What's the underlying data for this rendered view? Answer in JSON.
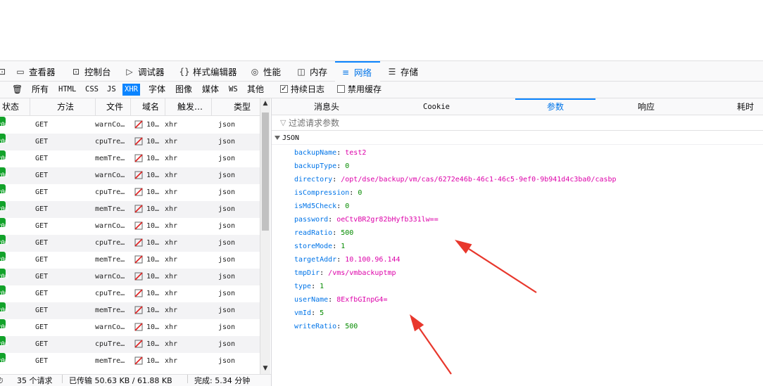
{
  "toolbar": {
    "tabs": [
      {
        "label": "查看器",
        "icon": "inspector-icon"
      },
      {
        "label": "控制台",
        "icon": "console-icon"
      },
      {
        "label": "调试器",
        "icon": "debugger-icon"
      },
      {
        "label": "样式编辑器",
        "icon": "style-editor-icon"
      },
      {
        "label": "性能",
        "icon": "performance-icon"
      },
      {
        "label": "内存",
        "icon": "memory-icon"
      },
      {
        "label": "网络",
        "icon": "network-icon",
        "active": true
      },
      {
        "label": "存储",
        "icon": "storage-icon"
      }
    ]
  },
  "filters": {
    "types": [
      "所有",
      "HTML",
      "CSS",
      "JS",
      "XHR",
      "字体",
      "图像",
      "媒体",
      "WS",
      "其他"
    ],
    "active_type": "XHR",
    "persist_logs": {
      "label": "持续日志",
      "checked": true
    },
    "disable_cache": {
      "label": "禁用缓存",
      "checked": false
    }
  },
  "table": {
    "columns": [
      "状态",
      "方法",
      "文件",
      "域名",
      "触发…",
      "类型"
    ],
    "rows": [
      {
        "status": "200",
        "method": "GET",
        "file": "warnCo…",
        "domain": "10…",
        "cause": "xhr",
        "type": "json"
      },
      {
        "status": "200",
        "method": "GET",
        "file": "cpuTre…",
        "domain": "10…",
        "cause": "xhr",
        "type": "json"
      },
      {
        "status": "200",
        "method": "GET",
        "file": "memTre…",
        "domain": "10…",
        "cause": "xhr",
        "type": "json"
      },
      {
        "status": "200",
        "method": "GET",
        "file": "warnCo…",
        "domain": "10…",
        "cause": "xhr",
        "type": "json"
      },
      {
        "status": "200",
        "method": "GET",
        "file": "cpuTre…",
        "domain": "10…",
        "cause": "xhr",
        "type": "json"
      },
      {
        "status": "200",
        "method": "GET",
        "file": "memTre…",
        "domain": "10…",
        "cause": "xhr",
        "type": "json"
      },
      {
        "status": "200",
        "method": "GET",
        "file": "warnCo…",
        "domain": "10…",
        "cause": "xhr",
        "type": "json"
      },
      {
        "status": "200",
        "method": "GET",
        "file": "cpuTre…",
        "domain": "10…",
        "cause": "xhr",
        "type": "json"
      },
      {
        "status": "200",
        "method": "GET",
        "file": "memTre…",
        "domain": "10…",
        "cause": "xhr",
        "type": "json"
      },
      {
        "status": "200",
        "method": "GET",
        "file": "warnCo…",
        "domain": "10…",
        "cause": "xhr",
        "type": "json"
      },
      {
        "status": "200",
        "method": "GET",
        "file": "cpuTre…",
        "domain": "10…",
        "cause": "xhr",
        "type": "json"
      },
      {
        "status": "200",
        "method": "GET",
        "file": "memTre…",
        "domain": "10…",
        "cause": "xhr",
        "type": "json"
      },
      {
        "status": "200",
        "method": "GET",
        "file": "warnCo…",
        "domain": "10…",
        "cause": "xhr",
        "type": "json"
      },
      {
        "status": "200",
        "method": "GET",
        "file": "cpuTre…",
        "domain": "10…",
        "cause": "xhr",
        "type": "json"
      },
      {
        "status": "200",
        "method": "GET",
        "file": "memTre…",
        "domain": "10…",
        "cause": "xhr",
        "type": "json"
      }
    ]
  },
  "statusbar": {
    "requests": "35 个请求",
    "transferred": "已传输 50.63 KB / 61.88 KB",
    "finish": "完成: 5.34 分钟"
  },
  "details": {
    "tabs": [
      "消息头",
      "Cookie",
      "参数",
      "响应",
      "耗时"
    ],
    "active_tab": "参数",
    "filter_placeholder": "过滤请求参数",
    "json_label": "JSON",
    "params": [
      {
        "key": "backupName",
        "value": "test2",
        "kind": "str"
      },
      {
        "key": "backupType",
        "value": "0",
        "kind": "num"
      },
      {
        "key": "directory",
        "value": "/opt/dse/backup/vm/cas/6272e46b-46c1-46c5-9ef0-9b941d4c3ba0/casbp",
        "kind": "str"
      },
      {
        "key": "isCompression",
        "value": "0",
        "kind": "num"
      },
      {
        "key": "isMd5Check",
        "value": "0",
        "kind": "num"
      },
      {
        "key": "password",
        "value": "oeCtvBR2gr82bHyfb331lw==",
        "kind": "str"
      },
      {
        "key": "readRatio",
        "value": "500",
        "kind": "num"
      },
      {
        "key": "storeMode",
        "value": "1",
        "kind": "num"
      },
      {
        "key": "targetAddr",
        "value": "10.100.96.144",
        "kind": "str"
      },
      {
        "key": "tmpDir",
        "value": "/vms/vmbackuptmp",
        "kind": "str"
      },
      {
        "key": "type",
        "value": "1",
        "kind": "num"
      },
      {
        "key": "userName",
        "value": "8ExfbGInpG4=",
        "kind": "str"
      },
      {
        "key": "vmId",
        "value": "5",
        "kind": "num"
      },
      {
        "key": "writeRatio",
        "value": "500",
        "kind": "num"
      }
    ]
  },
  "annotation_color": "#e8372c"
}
